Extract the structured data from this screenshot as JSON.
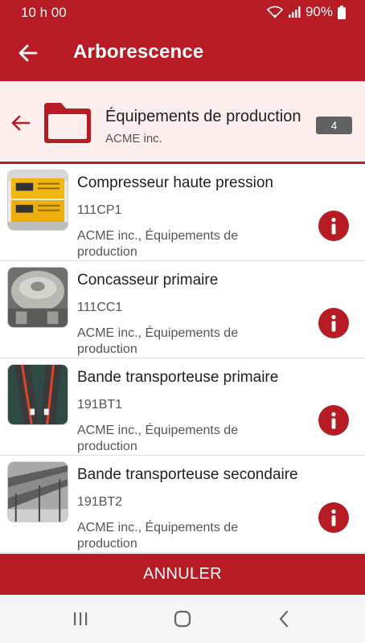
{
  "status": {
    "time": "10 h 00",
    "battery_text": "90%"
  },
  "app_bar": {
    "title": "Arborescence"
  },
  "folder": {
    "title": "Équipements de production",
    "subtitle": "ACME inc.",
    "count": "4"
  },
  "items": [
    {
      "name": "Compresseur haute pression",
      "code": "111CP1",
      "path": "ACME inc., Équipements de production",
      "thumb": "compressor-image"
    },
    {
      "name": "Concasseur primaire",
      "code": "111CC1",
      "path": "ACME inc., Équipements de production",
      "thumb": "crusher-image"
    },
    {
      "name": "Bande transporteuse primaire",
      "code": "191BT1",
      "path": "ACME inc., Équipements de production",
      "thumb": "conveyor-image"
    },
    {
      "name": "Bande transporteuse secondaire",
      "code": "191BT2",
      "path": "ACME inc., Équipements de production",
      "thumb": "conveyor-secondary-image"
    }
  ],
  "footer": {
    "cancel_label": "ANNULER"
  },
  "colors": {
    "brand": "#b71c24",
    "header_bg": "#fbeeec",
    "badge": "#616161"
  },
  "icons": [
    "back-arrow-icon",
    "folder-icon",
    "info-icon",
    "wifi-icon",
    "signal-icon",
    "battery-icon",
    "recent-apps-icon",
    "home-icon",
    "system-back-icon"
  ]
}
